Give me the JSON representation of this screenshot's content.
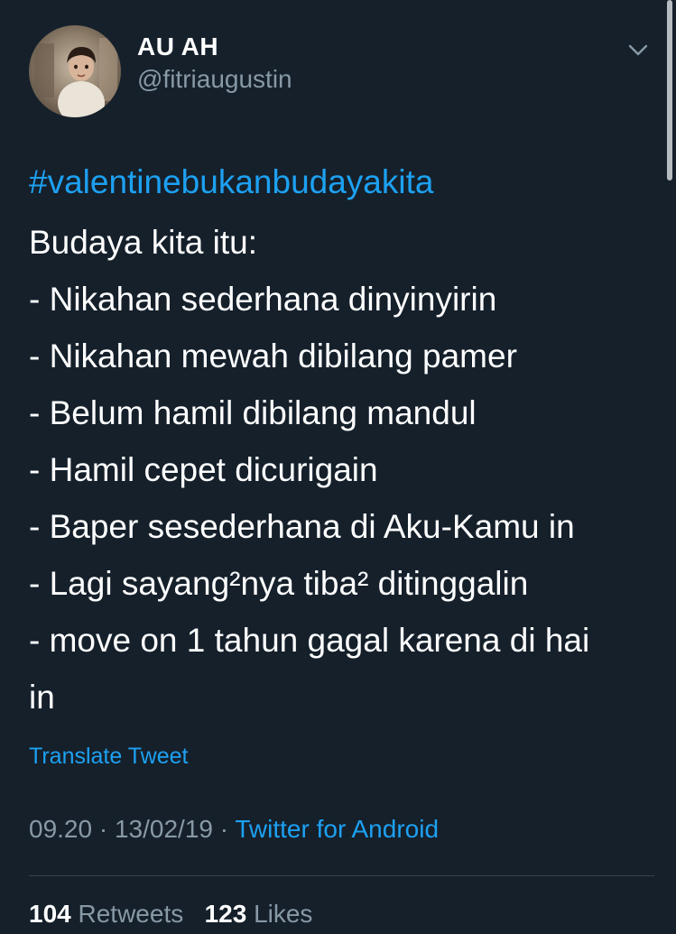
{
  "user": {
    "display_name": "AU AH",
    "handle": "@fitriaugustin",
    "avatar_desc": "profile photo"
  },
  "tweet": {
    "hashtag": "#valentinebukanbudayakita",
    "lines": [
      "Budaya kita itu:",
      "- Nikahan sederhana dinyinyirin",
      "- Nikahan mewah dibilang pamer",
      "- Belum hamil dibilang mandul",
      "- Hamil cepet dicurigain",
      "- Baper sesederhana di Aku-Kamu in",
      "- Lagi sayang²nya tiba² ditinggalin",
      "- move on 1 tahun gagal karena di hai",
      "in"
    ],
    "translate_label": "Translate Tweet",
    "time": "09.20",
    "date": "13/02/19",
    "separator": "·",
    "source": "Twitter for Android"
  },
  "stats": {
    "retweets_count": "104",
    "retweets_label": "Retweets",
    "likes_count": "123",
    "likes_label": "Likes"
  },
  "colors": {
    "background": "#15202b",
    "accent": "#1da1f2",
    "secondary_text": "#8899a6",
    "divider": "#38444d"
  },
  "icons": {
    "menu": "chevron-down-icon"
  }
}
